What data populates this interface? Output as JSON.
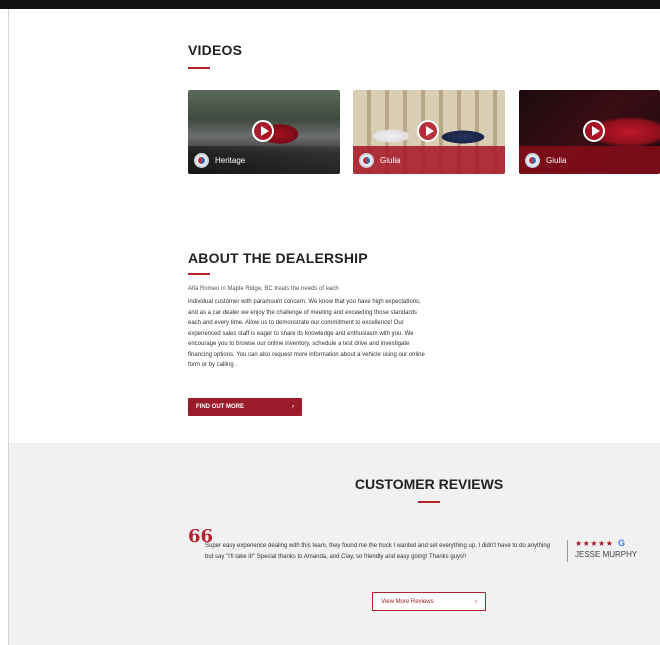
{
  "videos": {
    "title": "VIDEOS",
    "items": [
      {
        "caption": "Heritage"
      },
      {
        "caption": "Giulia"
      },
      {
        "caption": "Giulia"
      }
    ]
  },
  "about": {
    "title": "ABOUT THE DEALERSHIP",
    "lead": "Alfa Romeo in Maple Ridge, BC treats the needs of each",
    "body": "individual customer with paramount concern. We know that you have high expectations, and as a car dealer we enjoy the challenge of meeting and exceeding those standards each and every time. Allow us to demonstrate our commitment to excellence! Our experienced sales staff is eager to share its knowledge and enthusiasm with you. We encourage you to browse our online inventory, schedule a test drive and investigate financing options. You can also request more information about a vehicle using our online form or by calling .",
    "button_label": "FIND OUT MORE",
    "button_arrow": "›"
  },
  "reviews": {
    "title": "CUSTOMER REVIEWS",
    "quote_mark": "66",
    "text": "Super easy experience dealing with this team, they found me the truck I wanted and set everything up, I didn't have to do anything but say \"I'll take it!\" Special thanks to Amanda, and Clay, so friendly and easy going! Thanks guys!!",
    "stars": "★★★★★",
    "google_mark": "G",
    "reviewer": "JESSE MURPHY",
    "button_label": "View More Reviews",
    "button_arrow": "›"
  },
  "colors": {
    "accent": "#b4212f",
    "button": "#9b1b2a",
    "reviews_bg": "#f1f1f1"
  }
}
